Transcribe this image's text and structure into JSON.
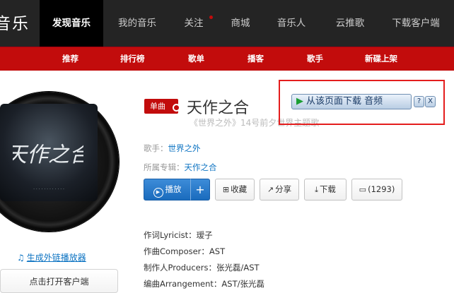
{
  "topnav": {
    "brand": "音乐",
    "items": [
      {
        "label": "发现音乐",
        "active": true
      },
      {
        "label": "我的音乐"
      },
      {
        "label": "关注",
        "dot": true
      },
      {
        "label": "商城"
      },
      {
        "label": "音乐人"
      },
      {
        "label": "云推歌"
      },
      {
        "label": "下载客户端"
      }
    ]
  },
  "subnav": {
    "items": [
      "推荐",
      "排行榜",
      "歌单",
      "播客",
      "歌手",
      "新碟上架"
    ]
  },
  "left": {
    "cover_text": "天作之合",
    "generate_link": "生成外链播放器",
    "open_client": "点击打开客户端"
  },
  "song": {
    "tag": "单曲",
    "title": "天作之合",
    "subtitle": "《世界之外》14号前夕世界主题歌",
    "singer_label": "歌手：",
    "singer": "世界之外",
    "album_label": "所属专辑：",
    "album": "天作之合"
  },
  "download": {
    "label": "从该页面下载 音频",
    "help": "?",
    "close": "X"
  },
  "actions": {
    "play": "播放",
    "add": "+",
    "collect": "收藏",
    "share": "分享",
    "download": "下载",
    "comment": "(1293)"
  },
  "credits": [
    "作词Lyricist：瑷子",
    "作曲Composer：AST",
    "制作人Producers：张光磊/AST",
    "编曲Arrangement：AST/张光磊"
  ],
  "colors": {
    "brand_red": "#c20c0c",
    "nav_bg": "#242424",
    "link_blue": "#0c73c2",
    "play_blue": "#1a6bbd"
  }
}
